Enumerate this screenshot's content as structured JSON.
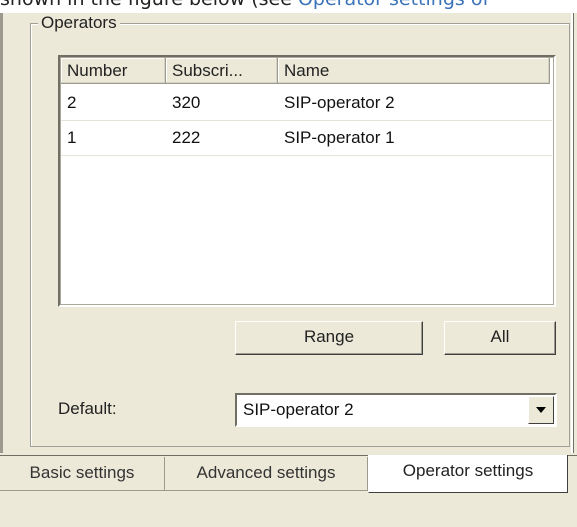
{
  "doc_text": {
    "before": "shown in the figure below (see ",
    "link": "Operator settings of"
  },
  "group": {
    "title": "Operators"
  },
  "listview": {
    "columns": [
      "Number",
      "Subscri...",
      "Name"
    ],
    "rows": [
      [
        "2",
        "320",
        "SIP-operator 2"
      ],
      [
        "1",
        "222",
        "SIP-operator 1"
      ]
    ]
  },
  "buttons": {
    "range": "Range",
    "all": "All"
  },
  "default": {
    "label": "Default:",
    "selected": "SIP-operator 2"
  },
  "tabs": [
    "Basic settings",
    "Advanced settings",
    "Operator settings"
  ],
  "active_tab": "Operator settings",
  "icons": {
    "combo_arrow": "chevron-down-icon"
  }
}
